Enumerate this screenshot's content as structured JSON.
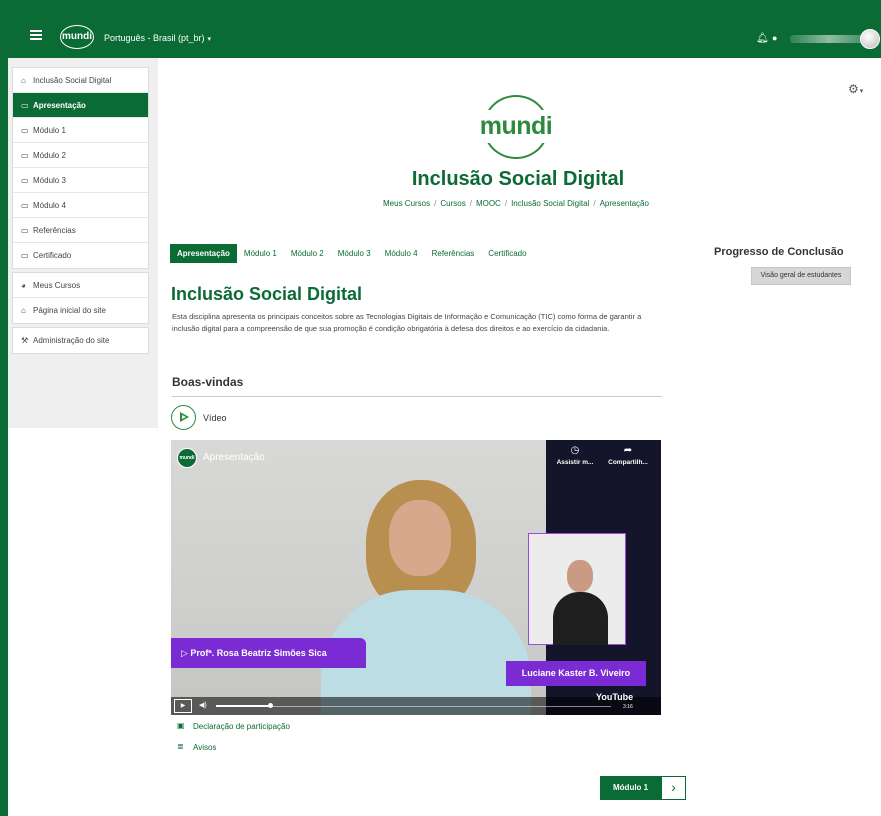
{
  "navbar": {
    "logo_text": "mundi",
    "language": "Português - Brasil (pt_br)",
    "language_caret": "▾",
    "bell_icon": "bell-icon",
    "chat_icon": "chat-icon"
  },
  "sidebar": {
    "course_items": [
      {
        "label": "Inclusão Social Digital",
        "icon": "graduation-cap-icon"
      },
      {
        "label": "Apresentação",
        "icon": "folder-icon",
        "active": true
      },
      {
        "label": "Módulo 1",
        "icon": "folder-icon"
      },
      {
        "label": "Módulo 2",
        "icon": "folder-icon"
      },
      {
        "label": "Módulo 3",
        "icon": "folder-icon"
      },
      {
        "label": "Módulo 4",
        "icon": "folder-icon"
      },
      {
        "label": "Referências",
        "icon": "folder-icon"
      },
      {
        "label": "Certificado",
        "icon": "folder-icon"
      }
    ],
    "site_items": [
      {
        "label": "Meus Cursos",
        "icon": "dashboard-icon"
      },
      {
        "label": "Página inicial do site",
        "icon": "home-icon"
      }
    ],
    "admin_items": [
      {
        "label": "Administração do site",
        "icon": "wrench-icon"
      }
    ]
  },
  "header": {
    "logo_text": "mundi",
    "course_title": "Inclusão Social Digital",
    "breadcrumb": [
      "Meus Cursos",
      "Cursos",
      "MOOC",
      "Inclusão Social Digital",
      "Apresentação"
    ]
  },
  "tabs": [
    {
      "label": "Apresentação",
      "active": true
    },
    {
      "label": "Módulo 1"
    },
    {
      "label": "Módulo 2"
    },
    {
      "label": "Módulo 3"
    },
    {
      "label": "Módulo 4"
    },
    {
      "label": "Referências"
    },
    {
      "label": "Certificado"
    }
  ],
  "progress": {
    "title": "Progresso de Conclusão",
    "students_button": "Visão geral de estudantes"
  },
  "main": {
    "title": "Inclusão Social Digital",
    "description": "Esta disciplina apresenta os principais conceitos sobre as Tecnologias Digitais de Informação e Comunicação (TIC) como forma de garantir a inclusão digital para a compreensão de que sua promoção é condição obrigatória à defesa dos direitos e ao exercício da cidadania.",
    "section_heading": "Boas-vindas",
    "video_label": "Vídeo"
  },
  "video": {
    "channel_logo": "mundi",
    "title": "Apresentação",
    "watch_later": "Assistir m...",
    "share": "Compartilh...",
    "presenter": "▷ Profª. Rosa Beatriz Simões Sica",
    "interpreter": "Luciane Kaster B. Viveiro",
    "youtube": "YouTube",
    "time": "3:16",
    "progress_fraction": 0.14
  },
  "links": {
    "declaration": "Declaração de participação",
    "notices": "Avisos"
  },
  "next": {
    "label": "Módulo 1",
    "arrow": "›"
  },
  "colors": {
    "brand_green": "#0b6b35",
    "logo_green": "#2e8b3e",
    "plate_purple": "#7b2bd3"
  }
}
